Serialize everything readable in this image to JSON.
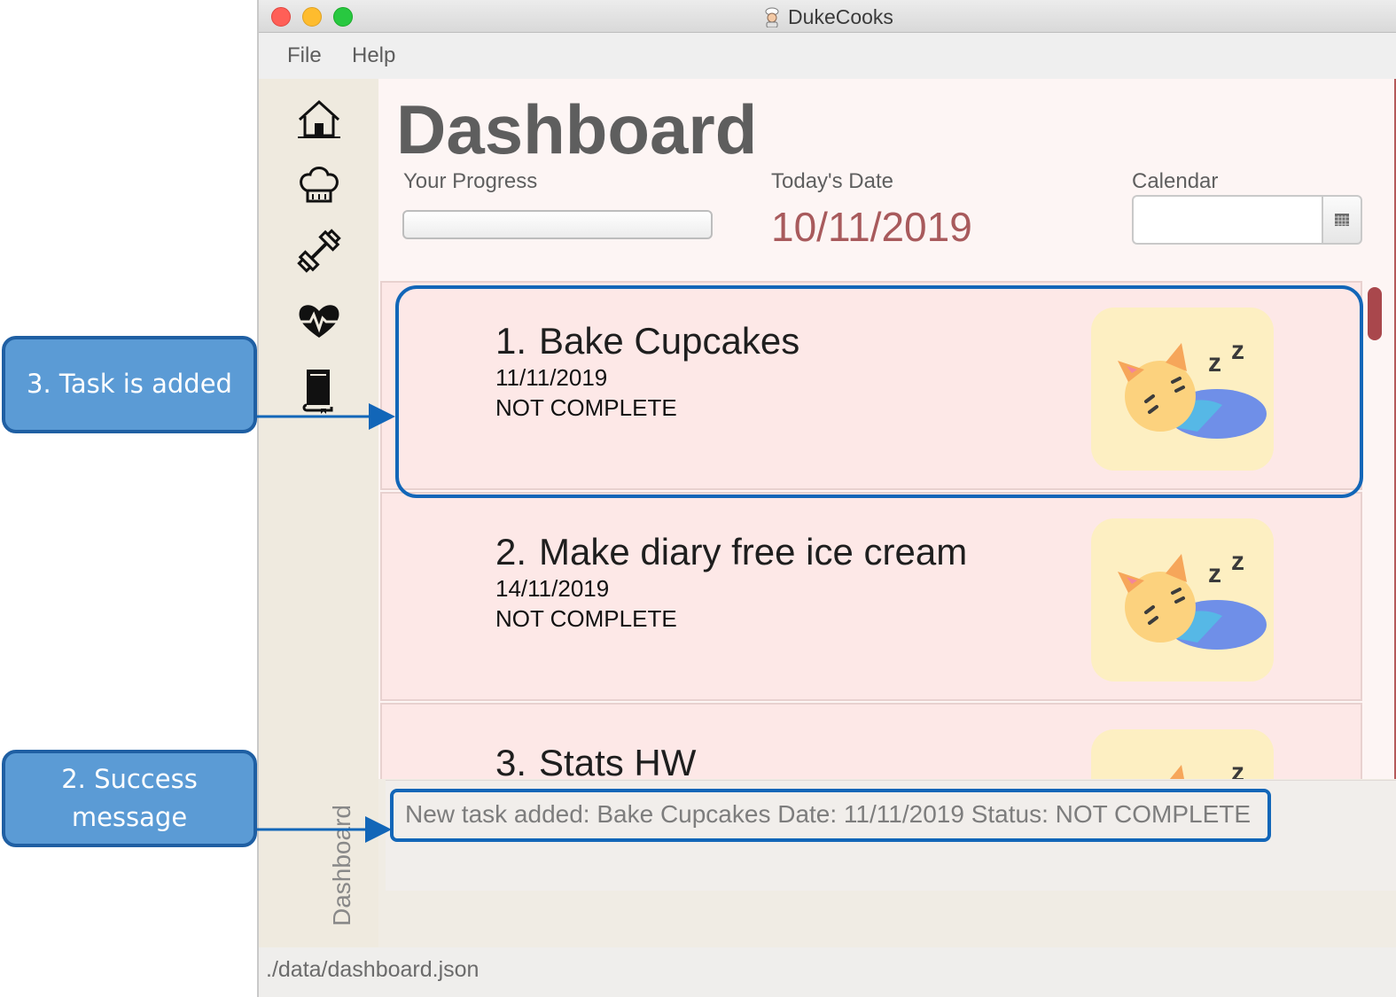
{
  "window": {
    "title": "DukeCooks",
    "menu": [
      "File",
      "Help"
    ]
  },
  "sidebar": {
    "icons": [
      "home-icon",
      "chef-hat-icon",
      "dumbbell-icon",
      "heartbeat-icon",
      "book-icon"
    ],
    "vertical_label": "Dashboard"
  },
  "dashboard": {
    "heading": "Dashboard",
    "progress_label": "Your Progress",
    "progress_value": 0,
    "date_label": "Today's Date",
    "date_value": "10/11/2019",
    "calendar_label": "Calendar",
    "calendar_value": ""
  },
  "tasks": [
    {
      "number": "1.",
      "title": "Bake Cupcakes",
      "date": "11/11/2019",
      "status": "NOT COMPLETE"
    },
    {
      "number": "2.",
      "title": "Make diary free ice cream",
      "date": "14/11/2019",
      "status": "NOT COMPLETE"
    },
    {
      "number": "3.",
      "title": "Stats HW",
      "date": "",
      "status": ""
    }
  ],
  "result": {
    "message": "New task added: Bake Cupcakes Date: 11/11/2019 Status: NOT COMPLETE"
  },
  "status_bar": {
    "path": "./data/dashboard.json"
  },
  "annotations": {
    "task_added": "3. Task is added",
    "success_line1": "2. Success",
    "success_line2": "message"
  },
  "colors": {
    "accent": "#a85a5c",
    "callout": "#5b9bd5",
    "callout_border": "#1f5fa3",
    "highlight": "#1266b8"
  }
}
